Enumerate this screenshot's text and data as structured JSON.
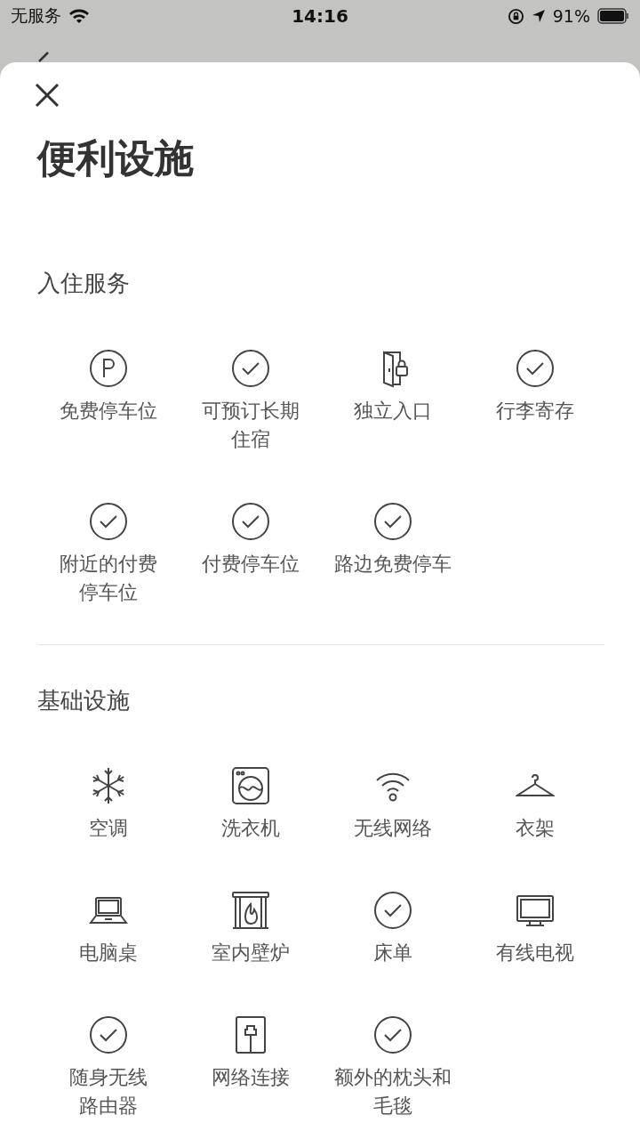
{
  "status_bar": {
    "carrier": "无服务",
    "time": "14:16",
    "battery": "91%"
  },
  "sheet": {
    "title": "便利设施",
    "sections": [
      {
        "heading": "入住服务",
        "items": [
          {
            "kind": "parking",
            "label_lines": [
              "免费停车位"
            ]
          },
          {
            "kind": "check",
            "label_lines": [
              "可预订长期",
              "住宿"
            ]
          },
          {
            "kind": "door",
            "label_lines": [
              "独立入口"
            ]
          },
          {
            "kind": "check",
            "label_lines": [
              "行李寄存"
            ]
          },
          {
            "kind": "check",
            "label_lines": [
              "附近的付费",
              "停车位"
            ]
          },
          {
            "kind": "check",
            "label_lines": [
              "付费停车位"
            ]
          },
          {
            "kind": "check",
            "label_lines": [
              "路边免费停车"
            ]
          }
        ]
      },
      {
        "heading": "基础设施",
        "items": [
          {
            "kind": "snowflake",
            "label_lines": [
              "空调"
            ]
          },
          {
            "kind": "washer",
            "label_lines": [
              "洗衣机"
            ]
          },
          {
            "kind": "wifi",
            "label_lines": [
              "无线网络"
            ]
          },
          {
            "kind": "hanger",
            "label_lines": [
              "衣架"
            ]
          },
          {
            "kind": "laptop",
            "label_lines": [
              "电脑桌"
            ]
          },
          {
            "kind": "fireplace",
            "label_lines": [
              "室内壁炉"
            ]
          },
          {
            "kind": "check",
            "label_lines": [
              "床单"
            ]
          },
          {
            "kind": "tv",
            "label_lines": [
              "有线电视"
            ]
          },
          {
            "kind": "check",
            "label_lines": [
              "随身无线",
              "路由器"
            ]
          },
          {
            "kind": "ethernet",
            "label_lines": [
              "网络连接"
            ]
          },
          {
            "kind": "check",
            "label_lines": [
              "额外的枕头和",
              "毛毯"
            ]
          }
        ]
      }
    ]
  }
}
